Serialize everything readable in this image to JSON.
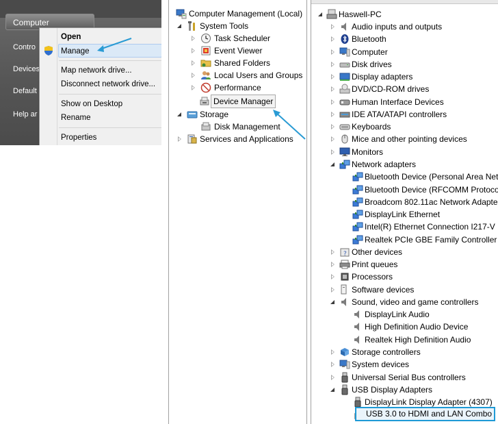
{
  "start_menu": {
    "items": [
      "Computer",
      "Contro",
      "Devices",
      "Default",
      "Help ar"
    ]
  },
  "context_menu": {
    "open": "Open",
    "manage": "Manage",
    "map_drive": "Map network drive...",
    "disconnect_drive": "Disconnect network drive...",
    "show_desktop": "Show on Desktop",
    "rename": "Rename",
    "properties": "Properties"
  },
  "computer_management": {
    "root": "Computer Management (Local)",
    "system_tools": "System Tools",
    "task_scheduler": "Task Scheduler",
    "event_viewer": "Event Viewer",
    "shared_folders": "Shared Folders",
    "local_users": "Local Users and Groups",
    "performance": "Performance",
    "device_manager": "Device Manager",
    "storage": "Storage",
    "disk_management": "Disk Management",
    "services": "Services and Applications"
  },
  "device_manager": {
    "root": "Haswell-PC",
    "items": [
      "Audio inputs and outputs",
      "Bluetooth",
      "Computer",
      "Disk drives",
      "Display adapters",
      "DVD/CD-ROM drives",
      "Human Interface Devices",
      "IDE ATA/ATAPI controllers",
      "Keyboards",
      "Mice and other pointing devices",
      "Monitors",
      "Network adapters",
      "Bluetooth Device (Personal Area Net",
      "Bluetooth Device (RFCOMM Protoco",
      "Broadcom 802.11ac Network Adapte",
      "DisplayLink Ethernet",
      "Intel(R) Ethernet Connection I217-V",
      "Realtek PCIe GBE Family Controller",
      "Other devices",
      "Print queues",
      "Processors",
      "Software devices",
      "Sound, video and game controllers",
      "DisplayLink Audio",
      "High Definition Audio Device",
      "Realtek High Definition Audio",
      "Storage controllers",
      "System devices",
      "Universal Serial Bus controllers",
      "USB Display Adapters",
      "DisplayLink Display Adapter (4307)",
      "USB 3.0 to HDMI and LAN Combo"
    ]
  },
  "colors": {
    "highlight_border": "#1e9ad6",
    "arrow": "#2a9bd4"
  }
}
